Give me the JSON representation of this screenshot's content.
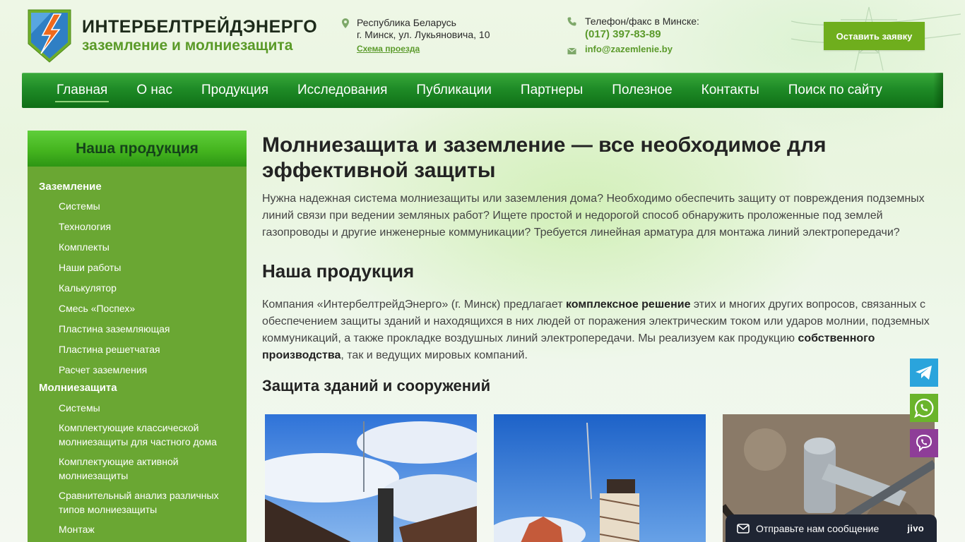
{
  "header": {
    "logo_title": "ИНТЕРБЕЛТРЕЙДЭНЕРГО",
    "logo_subtitle": "заземление и молниезащита",
    "address_line1": "Республика Беларусь",
    "address_line2": "г. Минск, ул. Лукьяновича, 10",
    "map_link": "Схема проезда",
    "phone_label": "Телефон/факс в Минске:",
    "phone": "(017) 397-83-89",
    "email": "info@zazemlenie.by",
    "order_button": "Оставить заявку"
  },
  "nav": {
    "items": [
      {
        "label": "Главная"
      },
      {
        "label": "О нас"
      },
      {
        "label": "Продукция"
      },
      {
        "label": "Исследования"
      },
      {
        "label": "Публикации"
      },
      {
        "label": "Партнеры"
      },
      {
        "label": "Полезное"
      },
      {
        "label": "Контакты"
      },
      {
        "label": "Поиск по сайту"
      }
    ],
    "active_index": 0
  },
  "sidebar": {
    "title": "Наша продукция",
    "grounding": {
      "label": "Заземление",
      "items": [
        "Системы",
        "Технология",
        "Комплекты",
        "Наши работы",
        "Калькулятор",
        "Смесь «Поспех»",
        "Пластина заземляющая",
        "Пластина решетчатая",
        "Расчет заземления"
      ]
    },
    "lightning": {
      "label": "Молниезащита",
      "items": [
        "Системы",
        "Комплектующие классической молниезащиты для частного дома",
        "Комплектующие активной молниезащиты",
        "Сравнительный анализ различных типов молниезащиты",
        "Монтаж"
      ]
    }
  },
  "main": {
    "title": "Молниезащита и заземление — все необходимое для эффективной защиты",
    "intro": "Нужна надежная система молниезащиты или заземления дома? Необходимо обеспечить защиту от повреждения подземных линий связи при ведении земляных работ? Ищете простой и недорогой способ обнаружить проложенные под землей газопроводы и другие инженерные коммуникации? Требуется линейная арматура для монтажа линий электропередачи?",
    "products_heading": "Наша продукция",
    "products_p_part1": "Компания «ИнтербелтрейдЭнерго» (г. Минск) предлагает ",
    "products_p_bold1": "комплексное решение",
    "products_p_part2": " этих и многих других вопросов, связанных с обеспечением защиты зданий и находящихся в них людей от поражения электрическим током или ударов молнии, подземных коммуникаций, а также прокладке воздушных линий электропередачи. Мы реализуем как продукцию ",
    "products_p_bold2": "собственного производства",
    "products_p_part3": ", так и ведущих мировых компаний.",
    "section_heading": "Защита зданий и сооружений"
  },
  "floating": {
    "telegram_icon": "telegram-icon",
    "whatsapp_icon": "whatsapp-icon",
    "viber_icon": "viber-icon"
  },
  "chat": {
    "label": "Отправьте нам сообщение",
    "brand": "jivo"
  },
  "colors": {
    "brand_green": "#6fae1d",
    "nav_green": "#1f8b27",
    "sidebar_green": "#6aa733",
    "link_green": "#5b9a2b"
  }
}
